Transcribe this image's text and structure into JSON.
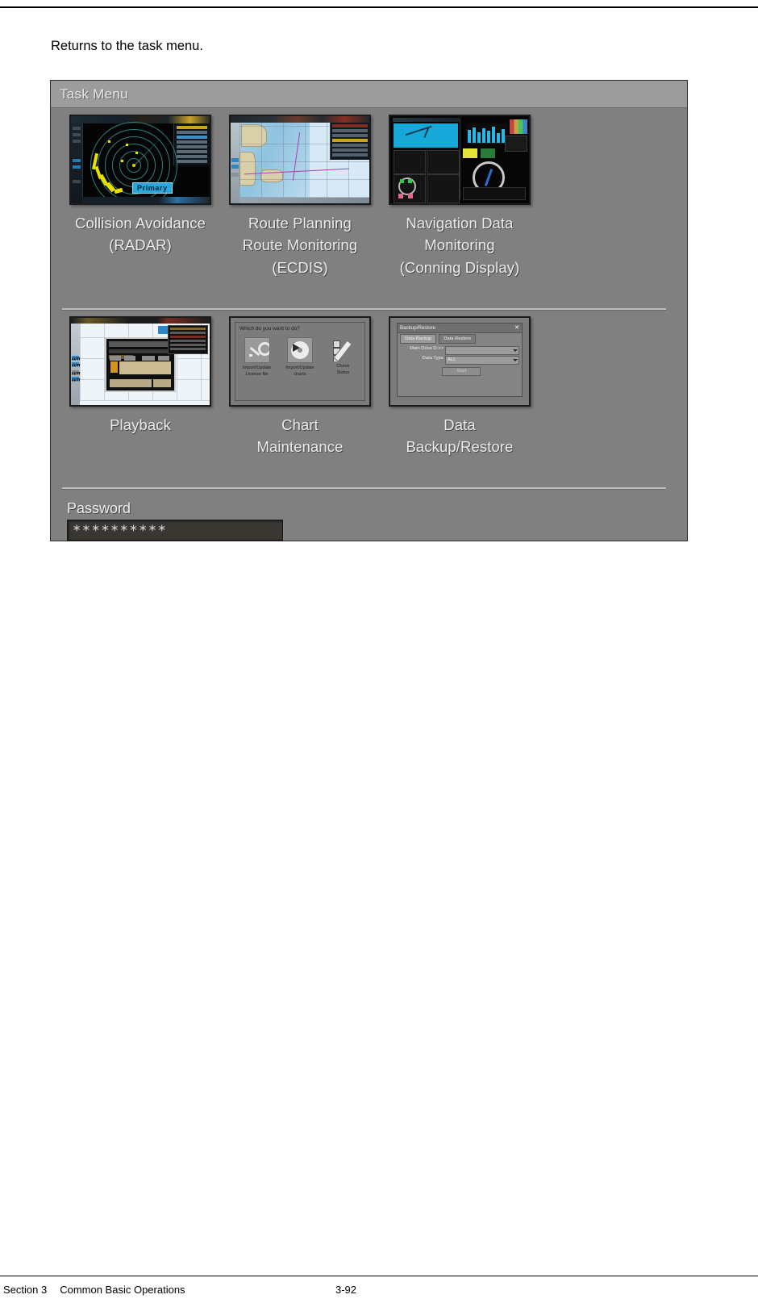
{
  "document": {
    "intro_text": "Returns to the task menu.",
    "footer": {
      "section": "Section 3",
      "chapter_title": "Common Basic Operations",
      "page_number": "3-92"
    }
  },
  "task_menu": {
    "title": "Task Menu",
    "tiles": [
      {
        "id": "collision-avoidance-radar",
        "label": "Collision Avoidance\n(RADAR)",
        "thumbnail": "radar-display-thumbnail",
        "badge": "Primary"
      },
      {
        "id": "route-planning-ecdis",
        "label": "Route Planning\nRoute Monitoring\n(ECDIS)",
        "thumbnail": "ecdis-chart-thumbnail"
      },
      {
        "id": "navigation-data-monitoring",
        "label": "Navigation Data\nMonitoring\n(Conning Display)",
        "thumbnail": "conning-display-thumbnail"
      },
      {
        "id": "playback",
        "label": "Playback",
        "thumbnail": "playback-window-thumbnail"
      },
      {
        "id": "chart-maintenance",
        "label": "Chart\nMaintenance",
        "thumbnail": "chart-maintenance-thumbnail"
      },
      {
        "id": "data-backup-restore",
        "label": "Data\nBackup/Restore",
        "thumbnail": "backup-restore-thumbnail"
      }
    ],
    "password": {
      "label": "Password",
      "value": "**********"
    }
  },
  "chart_maintenance_dialog": {
    "prompt": "Which do you want to do?",
    "actions": [
      {
        "icon": "key-icon",
        "label": "Import/Update\nLicense file"
      },
      {
        "icon": "disc-icon",
        "label": "Import/Update\ncharts"
      },
      {
        "icon": "checklist-pencil-icon",
        "label": "Check\nStatus"
      }
    ]
  },
  "backup_restore_dialog": {
    "title": "Backup/Restore",
    "close_label": "✕",
    "tabs": [
      {
        "label": "Data Backup",
        "active": true
      },
      {
        "label": "Data Restore",
        "active": false
      }
    ],
    "fields": [
      {
        "label": "Main Drive D:>>",
        "value": ""
      },
      {
        "label": "Data Type",
        "value": "ALL"
      }
    ],
    "start_button": "Start"
  },
  "colors": {
    "panel_body": "#808080",
    "panel_titlebar": "#9c9c9c",
    "label_text": "#ebebeb",
    "divider": "#bdbdbd",
    "password_field_bg": "#3a3632",
    "primary_badge": "#29a8e0"
  }
}
